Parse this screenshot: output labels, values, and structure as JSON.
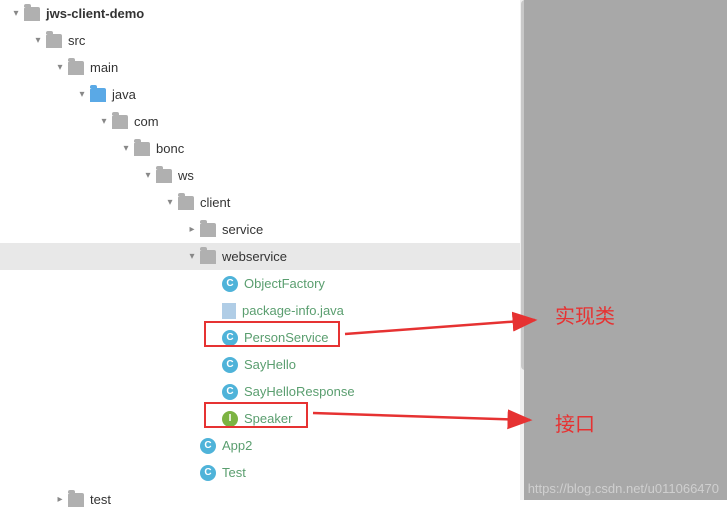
{
  "tree": {
    "root": "jws-client-demo",
    "src": "src",
    "main": "main",
    "java": "java",
    "com": "com",
    "bonc": "bonc",
    "ws": "ws",
    "client": "client",
    "service": "service",
    "webservice": "webservice",
    "objectFactory": "ObjectFactory",
    "packageInfo": "package-info.java",
    "personService": "PersonService",
    "sayHello": "SayHello",
    "sayHelloResponse": "SayHelloResponse",
    "speaker": "Speaker",
    "app2": "App2",
    "testClass": "Test",
    "test": "test"
  },
  "badges": {
    "c": "C",
    "i": "I"
  },
  "annotations": {
    "impl": "实现类",
    "iface": "接口"
  },
  "watermark": "https://blog.csdn.net/u011066470"
}
